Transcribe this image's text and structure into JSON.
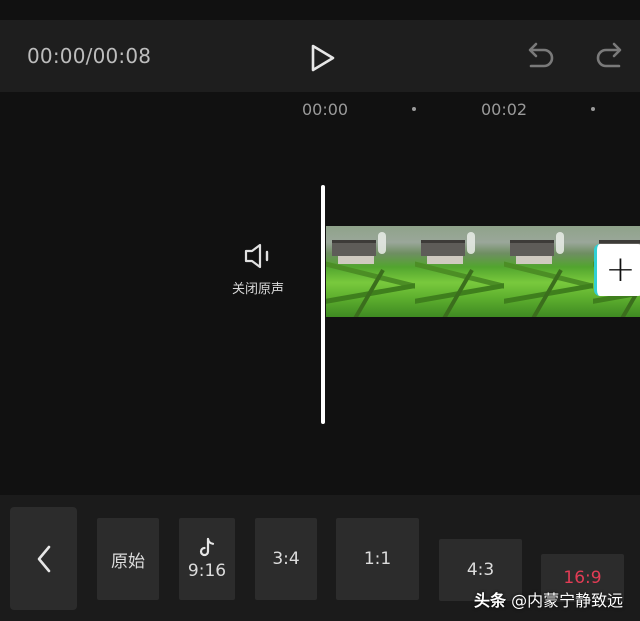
{
  "player": {
    "timecode": "00:00/00:08"
  },
  "timeline": {
    "ruler_labels": [
      "00:00",
      "00:02"
    ],
    "mute_label": "关闭原声",
    "frame_count": 4
  },
  "icons": {
    "play": "play-icon",
    "undo": "undo-icon",
    "redo": "redo-icon",
    "mute": "speaker-icon",
    "add": "plus-icon",
    "back": "chevron-left-icon",
    "tiktok": "tiktok-logo-icon"
  },
  "ratio_options": [
    {
      "label": "原始",
      "selected": false
    },
    {
      "label": "9:16",
      "selected": false
    },
    {
      "label": "3:4",
      "selected": false
    },
    {
      "label": "1:1",
      "selected": false
    },
    {
      "label": "4:3",
      "selected": false
    },
    {
      "label": "16:9",
      "selected": true
    }
  ],
  "colors": {
    "selected_accent": "#e23c55",
    "add_button_edge": "#31d0d4"
  },
  "watermark": {
    "brand": "头条",
    "handle": "@内蒙宁静致远"
  }
}
